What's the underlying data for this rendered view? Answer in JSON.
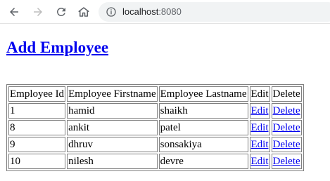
{
  "browser": {
    "host": "localhost",
    "port": ":8080"
  },
  "page": {
    "heading": "Add Employee"
  },
  "table": {
    "headers": [
      "Employee Id",
      "Employee Firstname",
      "Employee Lastname",
      "Edit",
      "Delete"
    ],
    "rows": [
      {
        "id": "1",
        "first": "hamid",
        "last": "shaikh",
        "edit": "Edit",
        "delete": "Delete"
      },
      {
        "id": "8",
        "first": "ankit",
        "last": "patel",
        "edit": "Edit",
        "delete": "Delete"
      },
      {
        "id": "9",
        "first": "dhruv",
        "last": "sonsakiya",
        "edit": "Edit",
        "delete": "Delete"
      },
      {
        "id": "10",
        "first": "nilesh",
        "last": "devre",
        "edit": "Edit",
        "delete": "Delete"
      }
    ]
  },
  "icons": {
    "back": "back-arrow-icon",
    "forward": "forward-arrow-icon",
    "reload": "reload-icon",
    "home": "home-icon",
    "info": "info-icon"
  },
  "colors": {
    "link": "#0000ee",
    "disabled_icon": "#bdbdbd",
    "icon": "#5f6368"
  }
}
